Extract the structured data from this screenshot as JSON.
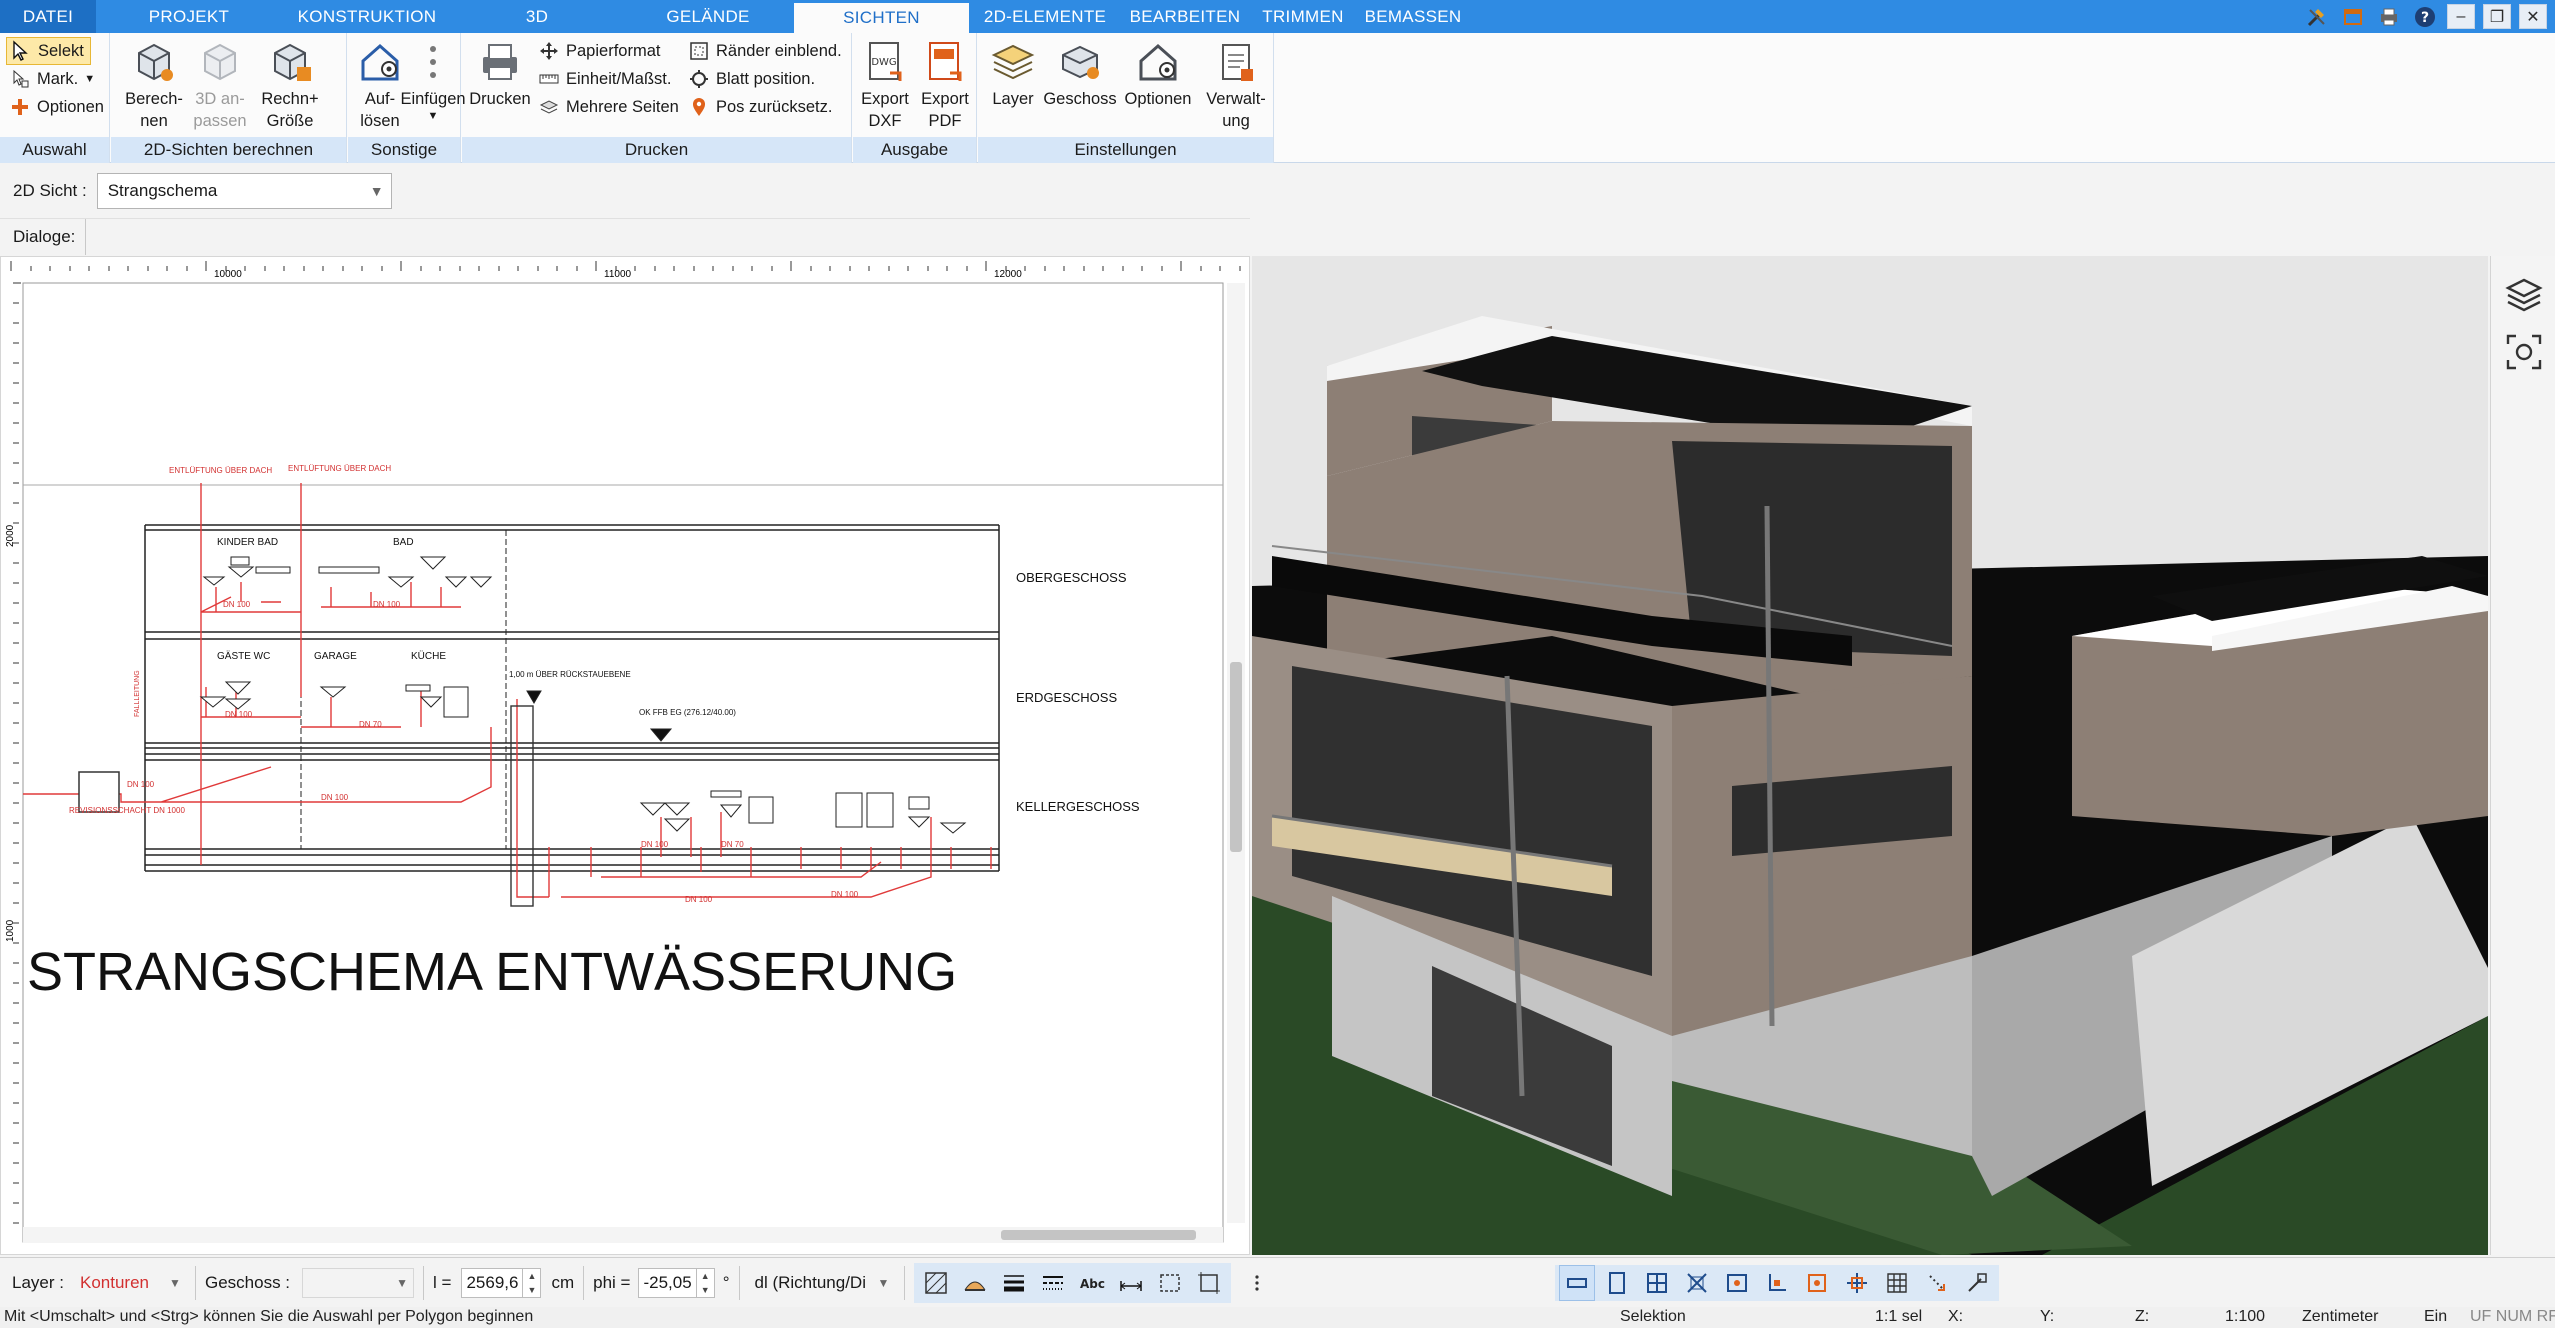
{
  "menu": {
    "tabs": [
      "DATEI",
      "PROJEKT",
      "KONSTRUKTION",
      "3D",
      "GELÄNDE",
      "SICHTEN",
      "2D-ELEMENTE",
      "BEARBEITEN",
      "TRIMMEN",
      "BEMASSEN"
    ],
    "active": "SICHTEN"
  },
  "ribbon": {
    "auswahl": {
      "title": "Auswahl",
      "select": "Selekt",
      "mark": "Mark.",
      "options": "Optionen"
    },
    "sichten": {
      "title": "2D-Sichten berechnen",
      "calc": "Berech-\nnen",
      "adjust3d": "3D an-\npassen",
      "calcsize": "Rechn+\nGröße"
    },
    "sonstige": {
      "title": "Sonstige",
      "dissolve": "Auf-\nlösen",
      "insert": "Einfügen"
    },
    "drucken": {
      "title": "Drucken",
      "print": "Drucken",
      "paper": "Papierformat",
      "unit": "Einheit/Maßst.",
      "pages": "Mehrere Seiten",
      "margins": "Ränder einblend.",
      "sheetpos": "Blatt position.",
      "posreset": "Pos zurücksetz."
    },
    "ausgabe": {
      "title": "Ausgabe",
      "dxf": "Export\nDXF",
      "pdf": "Export\nPDF"
    },
    "einstellungen": {
      "title": "Einstellungen",
      "layer": "Layer",
      "floor": "Geschoss",
      "options": "Optionen",
      "admin": "Verwalt-\nung"
    }
  },
  "view": {
    "label": "2D Sicht :",
    "value": "Strangschema"
  },
  "dialog": {
    "label": "Dialoge:"
  },
  "drawing": {
    "ruler_top": [
      "10000",
      "11000",
      "12000"
    ],
    "ruler_left": [
      "2000",
      "1000"
    ],
    "vents": [
      "ENTLÜFTUNG\nÜBER DACH",
      "ENTLÜFTUNG\nÜBER DACH"
    ],
    "rooms": [
      "KINDER BAD",
      "BAD",
      "GÄSTE WC",
      "GARAGE",
      "KÜCHE"
    ],
    "floors": [
      "OBERGESCHOSS",
      "ERDGESCHOSS",
      "KELLERGESCHOSS"
    ],
    "notes": [
      "1,00 m ÜBER\nRÜCKSTAUEBENE",
      "OK FFB EG\n(276.12/40.00)",
      "REVISIONSSCHACHT\nDN 1000",
      "FALLLEITUNG"
    ],
    "pipes": [
      "DN 100",
      "DN 100",
      "DN 100",
      "DN 70",
      "DN 100",
      "DN 100",
      "DN 100",
      "DN 70",
      "DN 100",
      "DN 100"
    ],
    "title": "STRANGSCHEMA ENTWÄSSERUNG"
  },
  "bottom": {
    "layer_label": "Layer :",
    "layer_value": "Konturen",
    "floor_label": "Geschoss :",
    "floor_value": "",
    "length_label": "l =",
    "length_value": "2569,6",
    "length_unit": "cm",
    "phi_label": "phi =",
    "phi_value": "-25,05",
    "phi_unit": "°",
    "mode_value": "dl (Richtung/Di"
  },
  "status": {
    "hint": "Mit <Umschalt> und <Strg> können Sie die Auswahl per Polygon beginnen",
    "mode": "Selektion",
    "sel": "1:1 sel",
    "x": "X:",
    "y": "Y:",
    "z": "Z:",
    "scale": "1:100",
    "unit": "Zentimeter",
    "ein": "Ein",
    "flags": "UF NUM RF"
  },
  "colors": {
    "accent": "#2f8be3",
    "tab_file": "#1d6fc4",
    "ribbon_group": "#d6e6f8",
    "pipe_red": "#e03a3a",
    "layer_text": "#d23030"
  }
}
